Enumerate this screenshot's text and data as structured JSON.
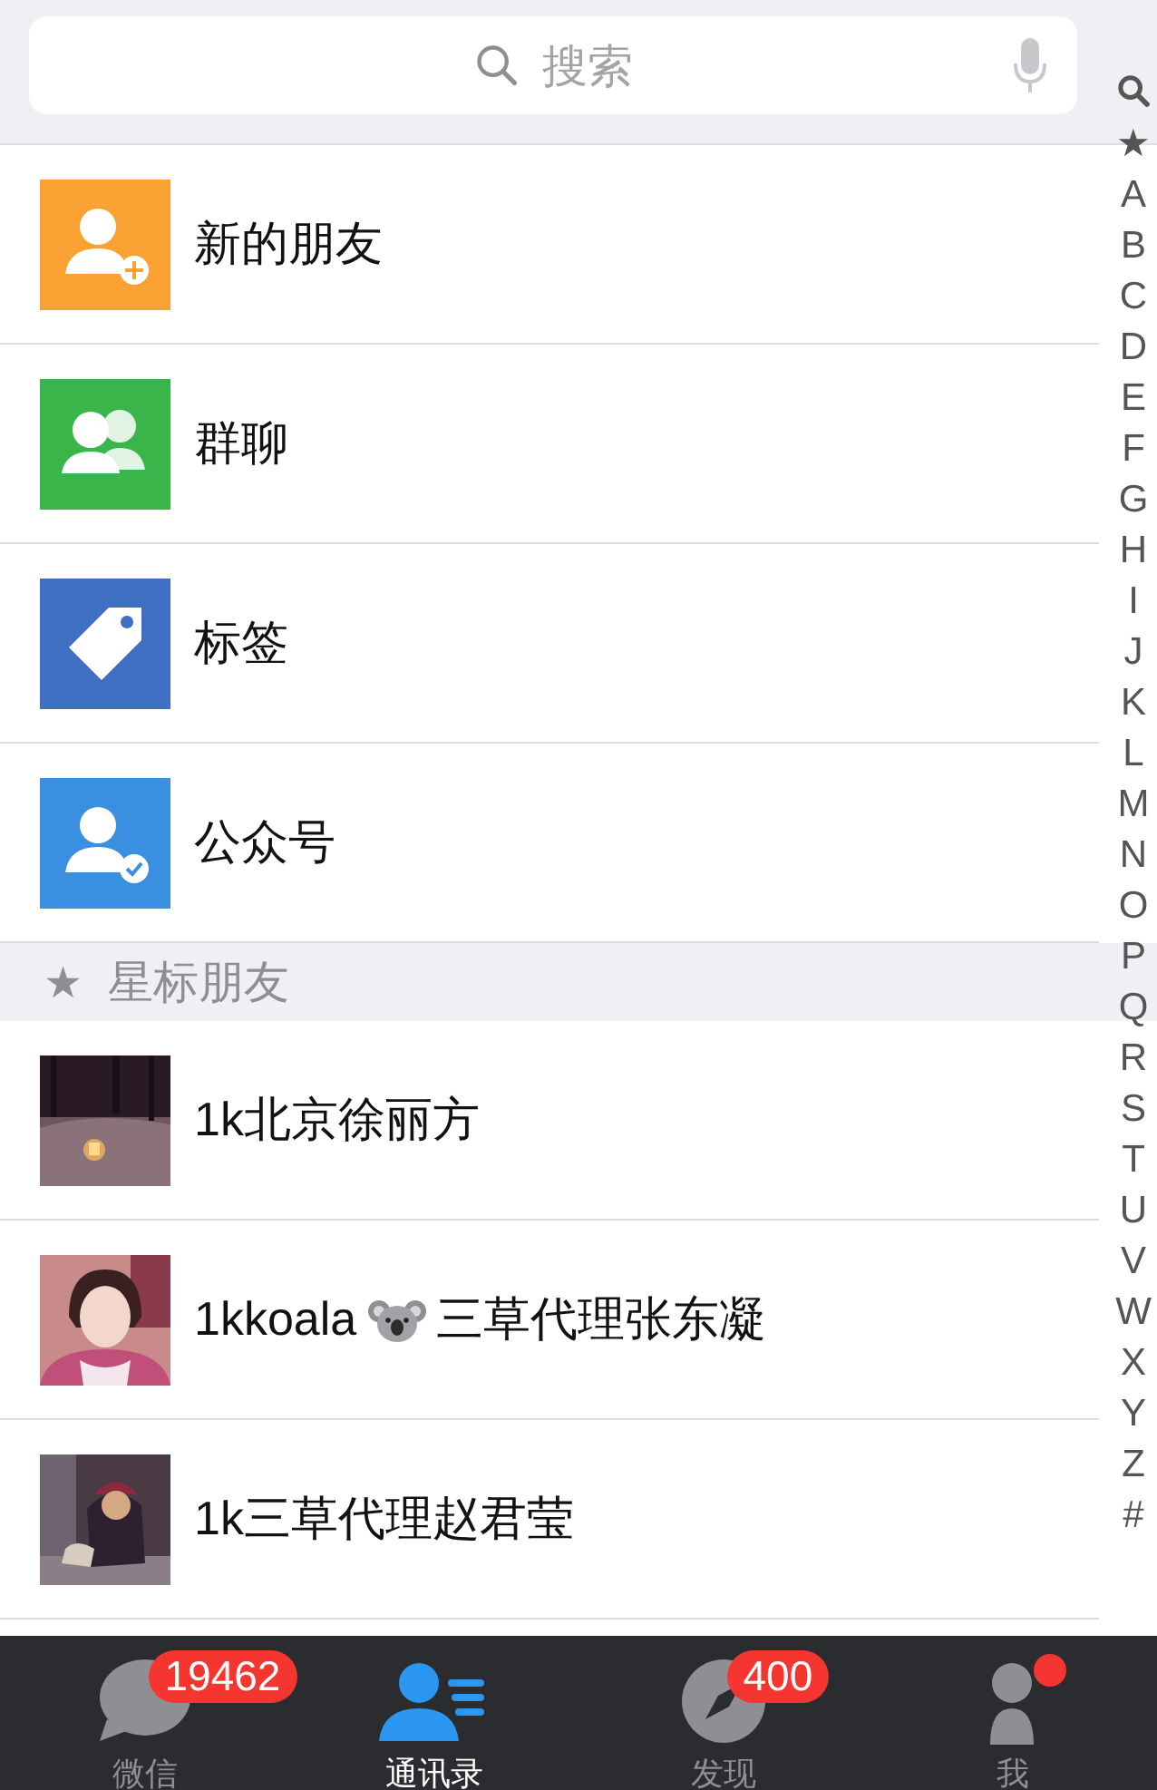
{
  "search": {
    "placeholder": "搜索"
  },
  "features": [
    {
      "kind": "new-friend",
      "label": "新的朋友",
      "color": "#f9a233"
    },
    {
      "kind": "group",
      "label": "群聊",
      "color": "#39b54a"
    },
    {
      "kind": "tag",
      "label": "标签",
      "color": "#3f6fc3"
    },
    {
      "kind": "official",
      "label": "公众号",
      "color": "#3b8fe0"
    }
  ],
  "section": {
    "star": "★",
    "title": "星标朋友"
  },
  "contacts": [
    {
      "kind": "night",
      "parts": [
        {
          "kind": "text",
          "text": "1k北京徐丽方"
        }
      ]
    },
    {
      "kind": "portrait",
      "parts": [
        {
          "kind": "text",
          "text": "1kkoala"
        },
        {
          "kind": "koala"
        },
        {
          "kind": "text",
          "text": "三草代理张东凝"
        }
      ]
    },
    {
      "kind": "seated",
      "parts": [
        {
          "kind": "text",
          "text": "1k三草代理赵君莹"
        }
      ]
    }
  ],
  "index": [
    "★",
    "A",
    "B",
    "C",
    "D",
    "E",
    "F",
    "G",
    "H",
    "I",
    "J",
    "K",
    "L",
    "M",
    "N",
    "O",
    "P",
    "Q",
    "R",
    "S",
    "T",
    "U",
    "V",
    "W",
    "X",
    "Y",
    "Z",
    "#"
  ],
  "tabs": [
    {
      "kind": "chat",
      "label": "微信",
      "selected": false,
      "badge": "19462",
      "dot": false
    },
    {
      "kind": "contacts",
      "label": "通讯录",
      "selected": true,
      "dot": false
    },
    {
      "kind": "discover",
      "label": "发现",
      "selected": false,
      "badge": "400",
      "dot": false
    },
    {
      "kind": "me",
      "label": "我",
      "selected": false,
      "dot": true
    }
  ]
}
